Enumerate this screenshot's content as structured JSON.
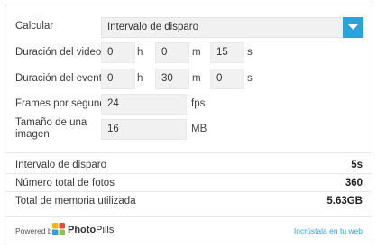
{
  "form": {
    "calcular_label": "Calcular",
    "calcular_value": "Intervalo de disparo",
    "video_label": "Duración del video",
    "video_h": "0",
    "video_m": "0",
    "video_s": "15",
    "evento_label": "Duración del evento",
    "evento_h": "0",
    "evento_m": "30",
    "evento_s": "0",
    "fps_label": "Frames por segundo",
    "fps_value": "24",
    "size_label_1": "Tamaño de una",
    "size_label_2": "imagen",
    "size_value": "16",
    "units": {
      "h": "h",
      "m": "m",
      "s": "s",
      "fps": "fps",
      "mb": "MB"
    }
  },
  "results": {
    "intervalo_label": "Intervalo de disparo",
    "intervalo_value": "5s",
    "fotos_label": "Número total de fotos",
    "fotos_value": "360",
    "memoria_label": "Total de memoria utilizada",
    "memoria_value": "5.63GB"
  },
  "footer": {
    "powered": "Powered by",
    "brand_bold": "Photo",
    "brand_thin": "Pills",
    "embed_link": "Incrústala en tu web"
  },
  "colors": {
    "accent": "#2ea2d8"
  }
}
